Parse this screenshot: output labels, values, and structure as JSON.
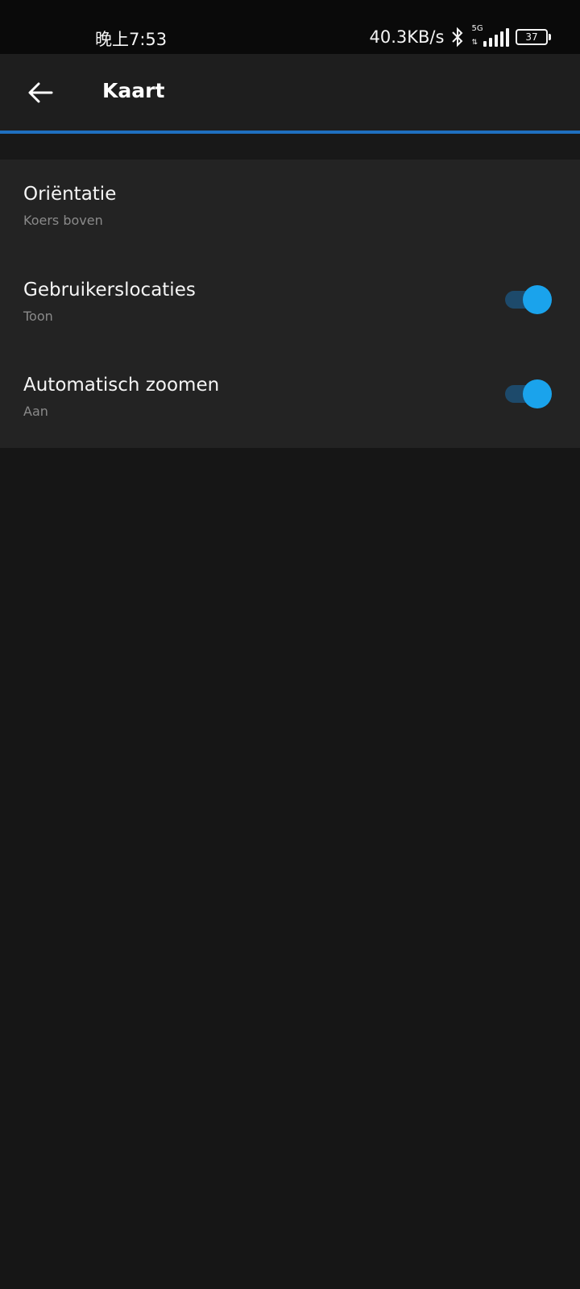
{
  "status_bar": {
    "time": "晚上7:53",
    "net_speed": "40.3KB/s",
    "network_type": "5G",
    "battery_level": "37"
  },
  "app_bar": {
    "title": "Kaart"
  },
  "settings": [
    {
      "title": "Oriëntatie",
      "subtitle": "Koers boven",
      "has_switch": false
    },
    {
      "title": "Gebruikerslocaties",
      "subtitle": "Toon",
      "has_switch": true,
      "switch_on": true
    },
    {
      "title": "Automatisch zoomen",
      "subtitle": "Aan",
      "has_switch": true,
      "switch_on": true
    }
  ],
  "colors": {
    "accent": "#1aa3ec",
    "progress": "#1f6fbf",
    "background": "#161616"
  }
}
